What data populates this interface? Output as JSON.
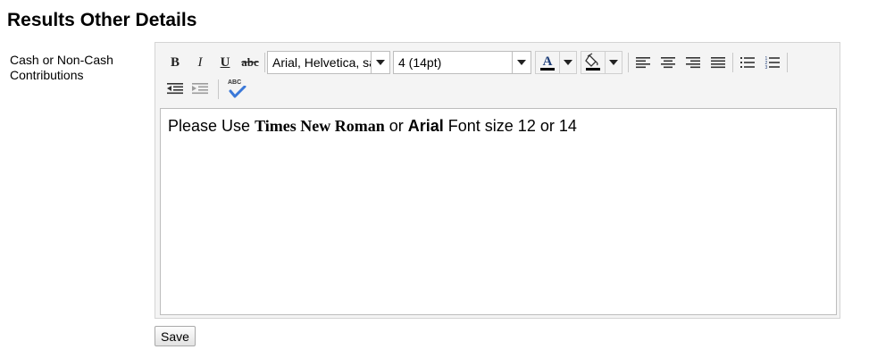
{
  "page": {
    "title": "Results Other Details"
  },
  "field": {
    "label": "Cash or Non-Cash Contributions"
  },
  "toolbar": {
    "bold_label": "B",
    "italic_label": "I",
    "underline_label": "U",
    "strike_label": "abc",
    "font_family_value": "Arial, Helvetica, sans-serif",
    "font_size_value": "4 (14pt)",
    "text_color": "#000000",
    "background_color": "#000000",
    "spell_label": "ABC"
  },
  "content": {
    "part1": "Please Use ",
    "part2": "Times New Roman",
    "part3": " or ",
    "part4": "Arial",
    "part5": " Font size 12 or 14"
  },
  "actions": {
    "save_label": "Save"
  }
}
